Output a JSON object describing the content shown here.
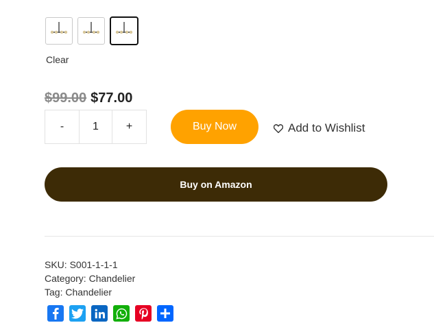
{
  "variation": {
    "swatches": [
      {
        "name": "Chandelier option 1",
        "selected": false
      },
      {
        "name": "Chandelier option 2",
        "selected": false
      },
      {
        "name": "Chandelier option 3",
        "selected": true
      }
    ],
    "clear_label": "Clear"
  },
  "price": {
    "old": "$99.00",
    "current": "$77.00"
  },
  "quantity": {
    "minus": "-",
    "value": "1",
    "plus": "+"
  },
  "actions": {
    "buy_now": "Buy Now",
    "wishlist": "Add to Wishlist",
    "amazon": "Buy on Amazon"
  },
  "meta": {
    "sku_label": "SKU:",
    "sku_value": "S001-1-1-1",
    "category_label": "Category:",
    "category_value": "Chandelier",
    "tag_label": "Tag:",
    "tag_value": "Chandelier"
  },
  "share": [
    {
      "name": "facebook",
      "glyph": "f",
      "color": "#1877f2"
    },
    {
      "name": "twitter",
      "glyph": "t",
      "color": "#1da1f2"
    },
    {
      "name": "linkedin",
      "glyph": "in",
      "color": "#0a66c2"
    },
    {
      "name": "whatsapp",
      "glyph": "w",
      "color": "#12af0a"
    },
    {
      "name": "pinterest",
      "glyph": "p",
      "color": "#e60023"
    },
    {
      "name": "share",
      "glyph": "+",
      "color": "#0166ff"
    }
  ],
  "colors": {
    "buy_now": "#ffa200",
    "amazon": "#3d2b06"
  }
}
